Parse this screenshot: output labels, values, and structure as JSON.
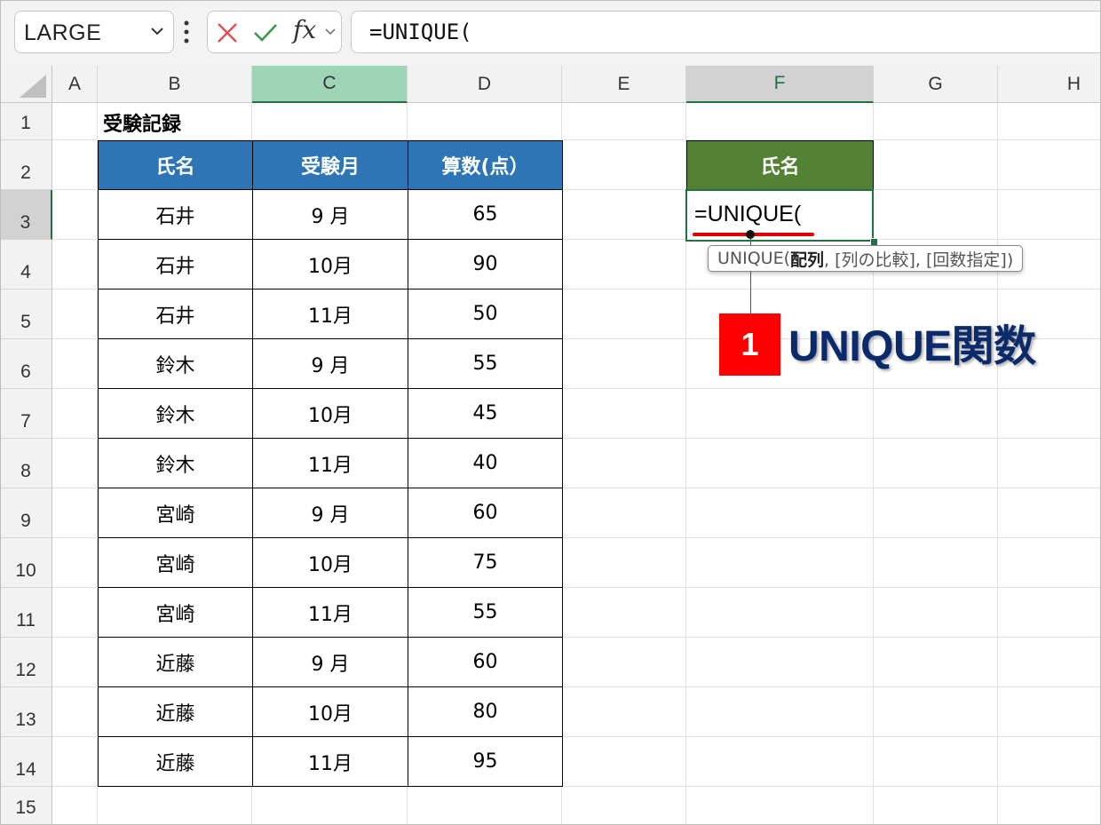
{
  "toolbar": {
    "name_box": "LARGE",
    "fx_label": "fx",
    "formula": "=UNIQUE("
  },
  "columns": [
    "A",
    "B",
    "C",
    "D",
    "E",
    "F",
    "G",
    "H"
  ],
  "rows": [
    "1",
    "2",
    "3",
    "4",
    "5",
    "6",
    "7",
    "8",
    "9",
    "10",
    "11",
    "12",
    "13",
    "14",
    "15"
  ],
  "sheet": {
    "title": "受験記録",
    "headers": [
      "氏名",
      "受験月",
      "算数(点）"
    ],
    "records": [
      [
        "石井",
        "9 月",
        "65"
      ],
      [
        "石井",
        "10月",
        "90"
      ],
      [
        "石井",
        "11月",
        "50"
      ],
      [
        "鈴木",
        "9 月",
        "55"
      ],
      [
        "鈴木",
        "10月",
        "45"
      ],
      [
        "鈴木",
        "11月",
        "40"
      ],
      [
        "宮崎",
        "9 月",
        "60"
      ],
      [
        "宮崎",
        "10月",
        "75"
      ],
      [
        "宮崎",
        "11月",
        "55"
      ],
      [
        "近藤",
        "9 月",
        "60"
      ],
      [
        "近藤",
        "10月",
        "80"
      ],
      [
        "近藤",
        "11月",
        "95"
      ]
    ],
    "f_header": "氏名",
    "active_cell_text": "=UNIQUE("
  },
  "tooltip": {
    "prefix": "UNIQUE(",
    "bold_arg": "配列",
    "rest": ", [列の比較], [回数指定])"
  },
  "annotation": {
    "number": "1",
    "label": "UNIQUE関数"
  },
  "colors": {
    "table_header": "#2e75b6",
    "result_header": "#548235",
    "accent_green": "#1f7244",
    "badge": "#ff0000",
    "callout_text": "#0b2a6b"
  }
}
